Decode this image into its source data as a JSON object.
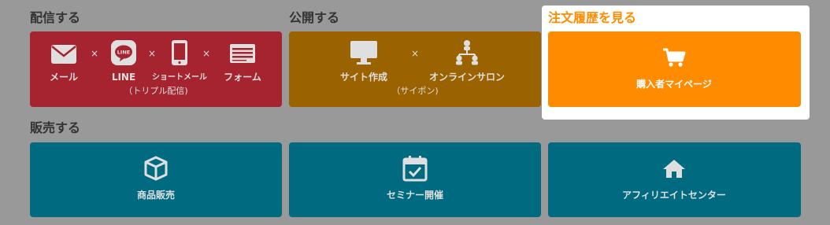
{
  "sections": {
    "deliver": {
      "title": "配信する",
      "card": {
        "items": [
          "メール",
          "LINE",
          "ショートメール",
          "フォーム"
        ],
        "separator": "×",
        "sub": "（トリプル配信)",
        "color": "#a52430"
      }
    },
    "publish": {
      "title": "公開する",
      "card": {
        "items": [
          "サイト作成",
          "オンラインサロン"
        ],
        "separator": "×",
        "sub": "（サイポン)",
        "color": "#9b6200"
      }
    },
    "orders": {
      "title": "注文履歴を見る",
      "title_color": "#ff8c00",
      "card": {
        "label": "購入者マイページ",
        "color": "#ff8c00"
      }
    },
    "sell": {
      "title": "販売する",
      "cards": [
        {
          "label": "商品販売",
          "icon": "box-icon"
        },
        {
          "label": "セミナー開催",
          "icon": "calendar-check-icon"
        },
        {
          "label": "アフィリエイトセンター",
          "icon": "home-icon"
        }
      ],
      "color": "#006a80"
    }
  },
  "icons": {
    "mail": "mail-icon",
    "line": "line-icon",
    "phone": "smartphone-icon",
    "form": "form-icon",
    "monitor": "monitor-icon",
    "network": "network-icon",
    "cart": "cart-icon"
  }
}
